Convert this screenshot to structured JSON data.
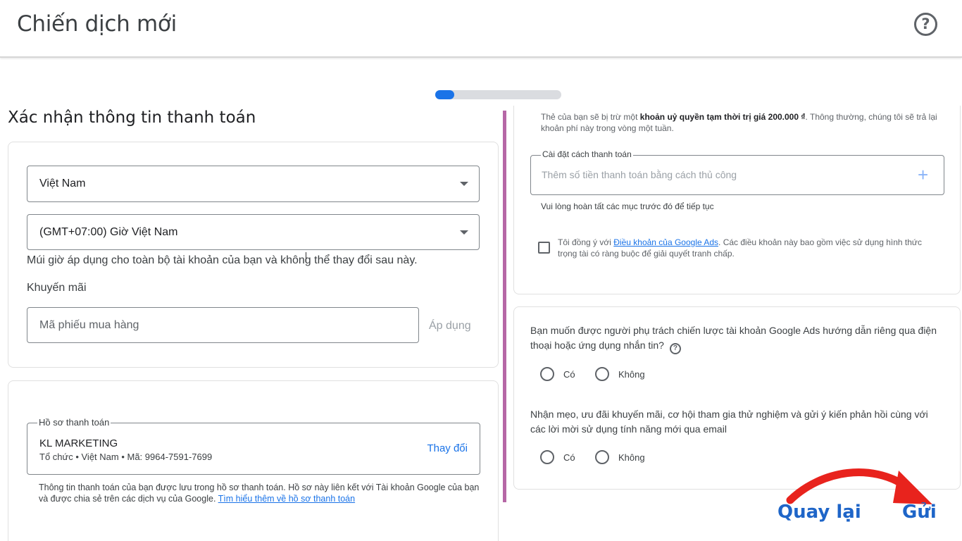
{
  "header": {
    "title": "Chiến dịch mới",
    "help_glyph": "?"
  },
  "progress": {
    "value_percent": 15
  },
  "left": {
    "heading": "Xác nhận thông tin thanh toán",
    "country_select": {
      "value": "Việt Nam"
    },
    "timezone_select": {
      "value": "(GMT+07:00) Giờ Việt Nam"
    },
    "timezone_helper": "Múi giờ áp dụng cho toàn bộ tài khoản của bạn và không thể thay đổi sau này.",
    "promo_label": "Khuyến mãi",
    "promo_placeholder": "Mã phiếu mua hàng",
    "apply_label": "Áp dụng",
    "billing_profile": {
      "legend": "Hồ sơ thanh toán",
      "name": "KL MARKETING",
      "details": "Tổ chức • Việt Nam • Mã: 9964-7591-7699",
      "change_label": "Thay đổi"
    },
    "billing_note_text": "Thông tin thanh toán của bạn được lưu trong hồ sơ thanh toán. Hồ sơ này liên kết với Tài khoản Google của bạn và được chia sẻ trên các dịch vụ của Google.",
    "billing_note_link": "Tìm hiểu thêm về hồ sơ thanh toán"
  },
  "right": {
    "auth_note_pre": "Thẻ của bạn sẽ bị trừ một ",
    "auth_note_bold": "khoản uỷ quyền tạm thời trị giá 200.000 ₫",
    "auth_note_post": ". Thông thường, chúng tôi sẽ trả lại khoản phí này trong vòng một tuần.",
    "payment_method": {
      "legend": "Cài đặt cách thanh toán",
      "placeholder": "Thêm số tiền thanh toán bằng cách thủ công",
      "plus_glyph": "+"
    },
    "payment_helper": "Vui lòng hoàn tất các mục trước đó để tiếp tục",
    "terms_pre": "Tôi đồng ý với ",
    "terms_link": "Điều khoản của Google Ads",
    "terms_post": ". Các điều khoản này bao gồm việc sử dụng hình thức trọng tài có ràng buộc để giải quyết tranh chấp.",
    "question1": "Bạn muốn được người phụ trách chiến lược tài khoản Google Ads hướng dẫn riêng qua điện thoại hoặc ứng dụng nhắn tin?",
    "question1_help_glyph": "?",
    "q1_options": [
      "Có",
      "Không"
    ],
    "question2": "Nhận mẹo, ưu đãi khuyến mãi, cơ hội tham gia thử nghiệm và gửi ý kiến phản hồi cùng với các lời mời sử dụng tính năng mới qua email",
    "q2_options": [
      "Có",
      "Không"
    ]
  },
  "footer": {
    "back_label": "Quay lại",
    "send_label": "Gửi"
  },
  "colors": {
    "accent": "#1a73e8",
    "divider": "#b667a6",
    "arrow": "#e8231d",
    "button_text": "#1e65c8"
  }
}
